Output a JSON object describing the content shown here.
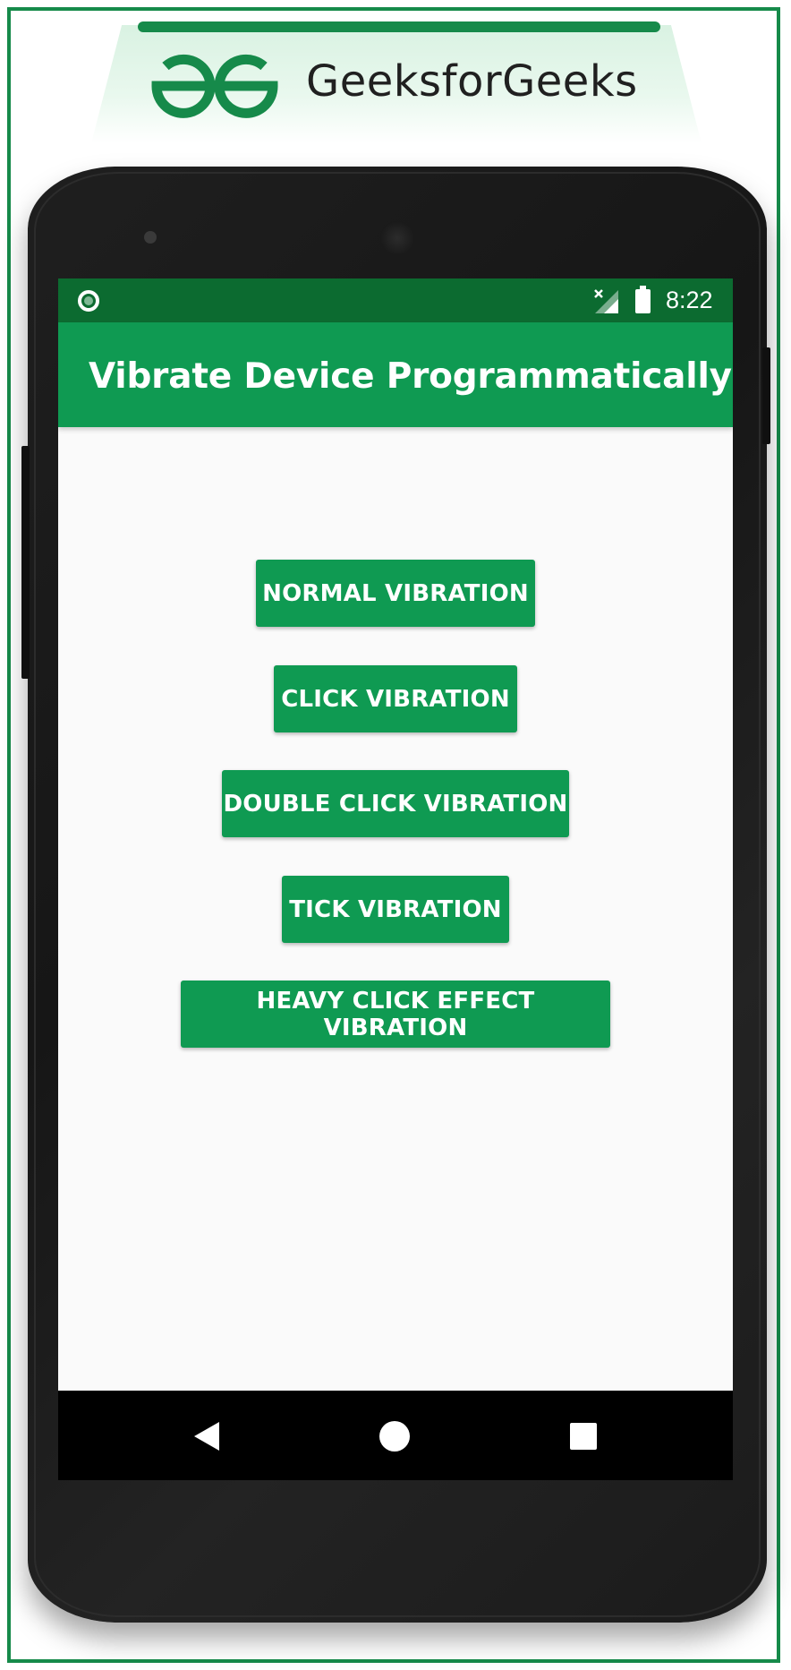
{
  "brand": {
    "name": "GeeksforGeeks",
    "color": "#168a4a"
  },
  "statusbar": {
    "time": "8:22",
    "icons": [
      "circle-notification-icon",
      "signal-off-icon",
      "battery-icon"
    ]
  },
  "app": {
    "title": "Vibrate Device Programmatically",
    "primary_color": "#0f9a52",
    "dark_color": "#0c6b30"
  },
  "buttons": [
    {
      "label": "NORMAL VIBRATION"
    },
    {
      "label": "CLICK VIBRATION"
    },
    {
      "label": "DOUBLE CLICK VIBRATION"
    },
    {
      "label": "TICK VIBRATION"
    },
    {
      "label": "HEAVY CLICK EFFECT VIBRATION"
    }
  ],
  "navbar": {
    "icons": [
      "back-icon",
      "home-icon",
      "recents-icon"
    ]
  }
}
